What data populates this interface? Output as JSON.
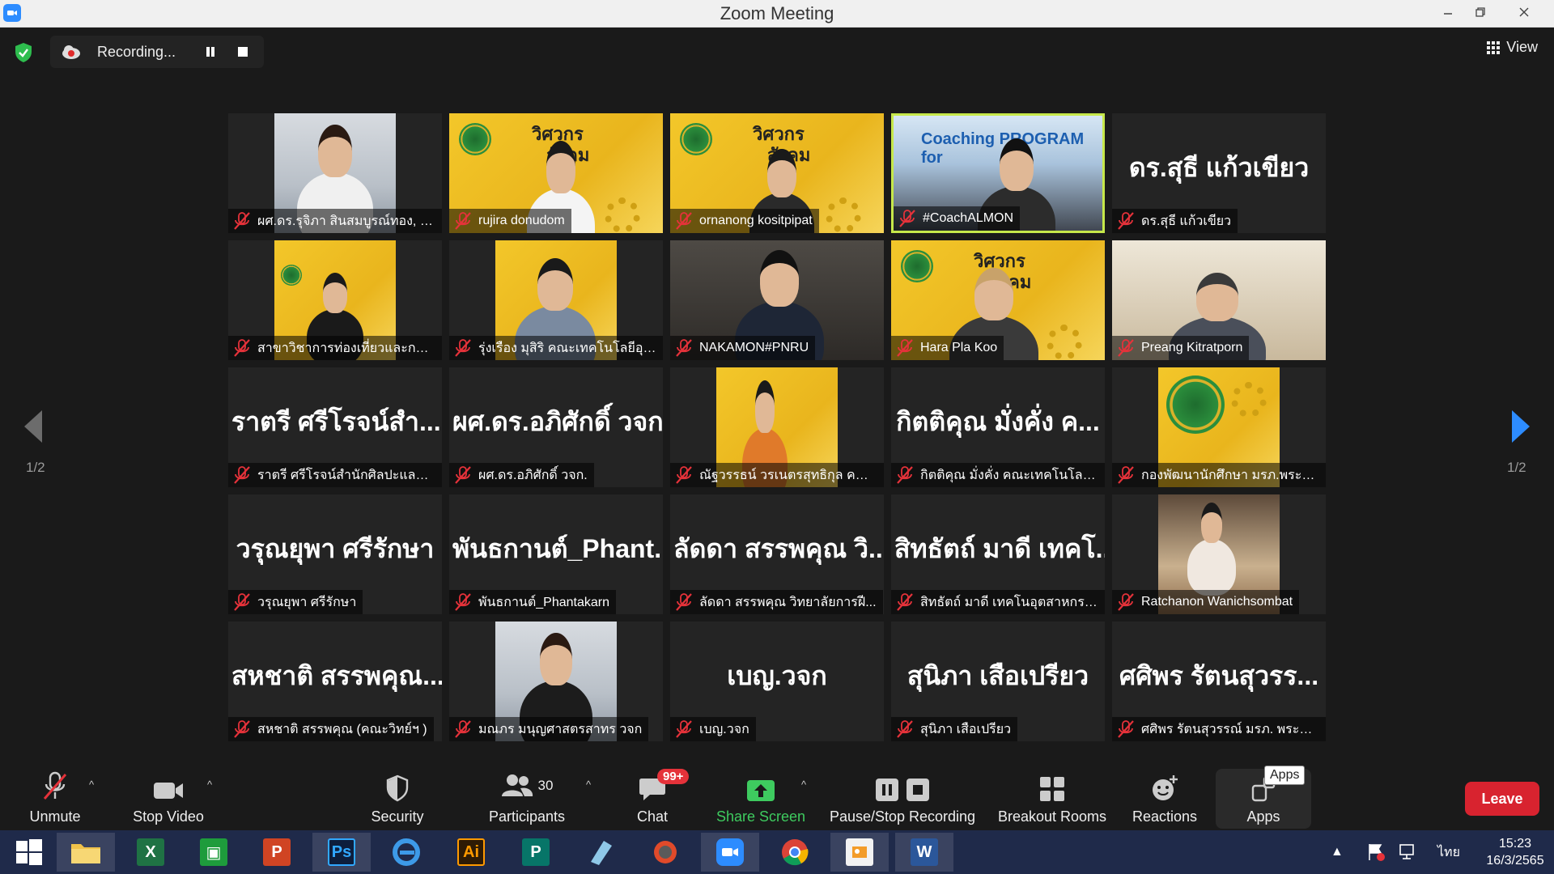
{
  "window": {
    "title": "Zoom Meeting"
  },
  "recording": {
    "label": "Recording..."
  },
  "view": {
    "label": "View"
  },
  "pagination": {
    "left": "1/2",
    "right": "1/2"
  },
  "tiles": [
    {
      "caption": "ผศ.ดร.รุจิภา สินสมบูรณ์ทอง, วจ...",
      "bigname": "",
      "video": "office-woman"
    },
    {
      "caption": "rujira donudom",
      "bigname": "",
      "video": "yellow-woman"
    },
    {
      "caption": "ornanong kositpipat",
      "bigname": "",
      "video": "yellow-man"
    },
    {
      "caption": "#CoachALMON",
      "bigname": "",
      "video": "coach",
      "active": true,
      "overlay": "Coaching PROGRAM for"
    },
    {
      "caption": "ดร.สุธี แก้วเขียว",
      "bigname": "ดร.สุธี  แก้วเขียว",
      "video": ""
    },
    {
      "caption": "สาขาวิชาการท่องเที่ยวและการโร...",
      "bigname": "",
      "video": "yellow-small"
    },
    {
      "caption": "รุ่งเรือง มุสิริ คณะเทคโนโลยีอุตส...",
      "bigname": "",
      "video": "yellow-man2"
    },
    {
      "caption": "NAKAMON#PNRU",
      "bigname": "",
      "video": "dark-man"
    },
    {
      "caption": "Hara Pla Koo",
      "bigname": "",
      "video": "yellow-woman2"
    },
    {
      "caption": "Preang Kitratporn",
      "bigname": "",
      "video": "room-man"
    },
    {
      "caption": "ราตรี   ศรีโรจน์สำนักศิลปะและวั...",
      "bigname": "ราตรี   ศรีโรจน์สำ...",
      "video": ""
    },
    {
      "caption": "ผศ.ดร.อภิศักดิ์ วจก.",
      "bigname": "ผศ.ดร.อภิศักดิ์ วจก.",
      "video": ""
    },
    {
      "caption": "ณัฐวรรธน์ วรเนตรสุทธิกุล คณะเ...",
      "bigname": "",
      "video": "yellow-stand"
    },
    {
      "caption": "กิตติคุณ  มั่งคั่ง คณะเทคโนโลยีอ...",
      "bigname": "กิตติคุณ  มั่งคั่ง ค...",
      "video": ""
    },
    {
      "caption": "กองพัฒนานักศึกษา มรภ.พระนคร",
      "bigname": "",
      "video": "yellow-logo"
    },
    {
      "caption": "วรุณยุพา ศรีรักษา",
      "bigname": "วรุณยุพา ศรีรักษา",
      "video": ""
    },
    {
      "caption": "พันธกานต์_Phantakarn",
      "bigname": "พันธกานต์_Phant...",
      "video": ""
    },
    {
      "caption": "ลัดดา สรรพคุณ วิทยาลัยการฝี...",
      "bigname": "ลัดดา สรรพคุณ วิ...",
      "video": ""
    },
    {
      "caption": "สิทธัตถ์ มาดี เทคโนอุตสาหกรรม",
      "bigname": "สิทธัตถ์ มาดี เทคโ...",
      "video": ""
    },
    {
      "caption": "Ratchanon Wanichsombat",
      "bigname": "",
      "video": "photo"
    },
    {
      "caption": "สหชาติ สรรพคุณ (คณะวิทย์ฯ )",
      "bigname": "สหชาติ สรรพคุณ...",
      "video": ""
    },
    {
      "caption": "มณภร มนุญศาสตรสาทร วจก",
      "bigname": "",
      "video": "office-woman2"
    },
    {
      "caption": "เบญ.วจก",
      "bigname": "เบญ.วจก",
      "video": ""
    },
    {
      "caption": "สุนิภา เสือเปรียว",
      "bigname": "สุนิภา เสือเปรียว",
      "video": ""
    },
    {
      "caption": "ศศิพร รัตนสุวรรณ์ มรภ. พระนคร",
      "bigname": "ศศิพร รัตนสุวรร...",
      "video": ""
    }
  ],
  "brand": {
    "line1": "วิศวกร",
    "line2": "สังคม"
  },
  "toolbar": {
    "unmute": "Unmute",
    "stop_video": "Stop Video",
    "security": "Security",
    "participants": "Participants",
    "participants_count": "30",
    "chat": "Chat",
    "chat_badge": "99+",
    "share_screen": "Share Screen",
    "pause_stop": "Pause/Stop Recording",
    "breakout": "Breakout Rooms",
    "reactions": "Reactions",
    "apps": "Apps",
    "apps_tooltip": "Apps",
    "leave": "Leave"
  },
  "taskbar": {
    "apps": [
      "windows-start",
      "file-explorer",
      "excel",
      "publisher-green",
      "powerpoint",
      "photoshop",
      "internet-explorer",
      "illustrator",
      "publisher",
      "notepad",
      "photoscape",
      "zoom",
      "chrome",
      "photo-viewer",
      "word"
    ],
    "ps_label": "Ps",
    "ai_label": "Ai",
    "lang": "ไทย",
    "time": "15:23",
    "date": "16/3/2565"
  },
  "colors": {
    "accent_blue": "#2d8cff",
    "leave_red": "#d8232f",
    "share_green": "#3ecb5f",
    "active_border": "#c6e84a"
  }
}
